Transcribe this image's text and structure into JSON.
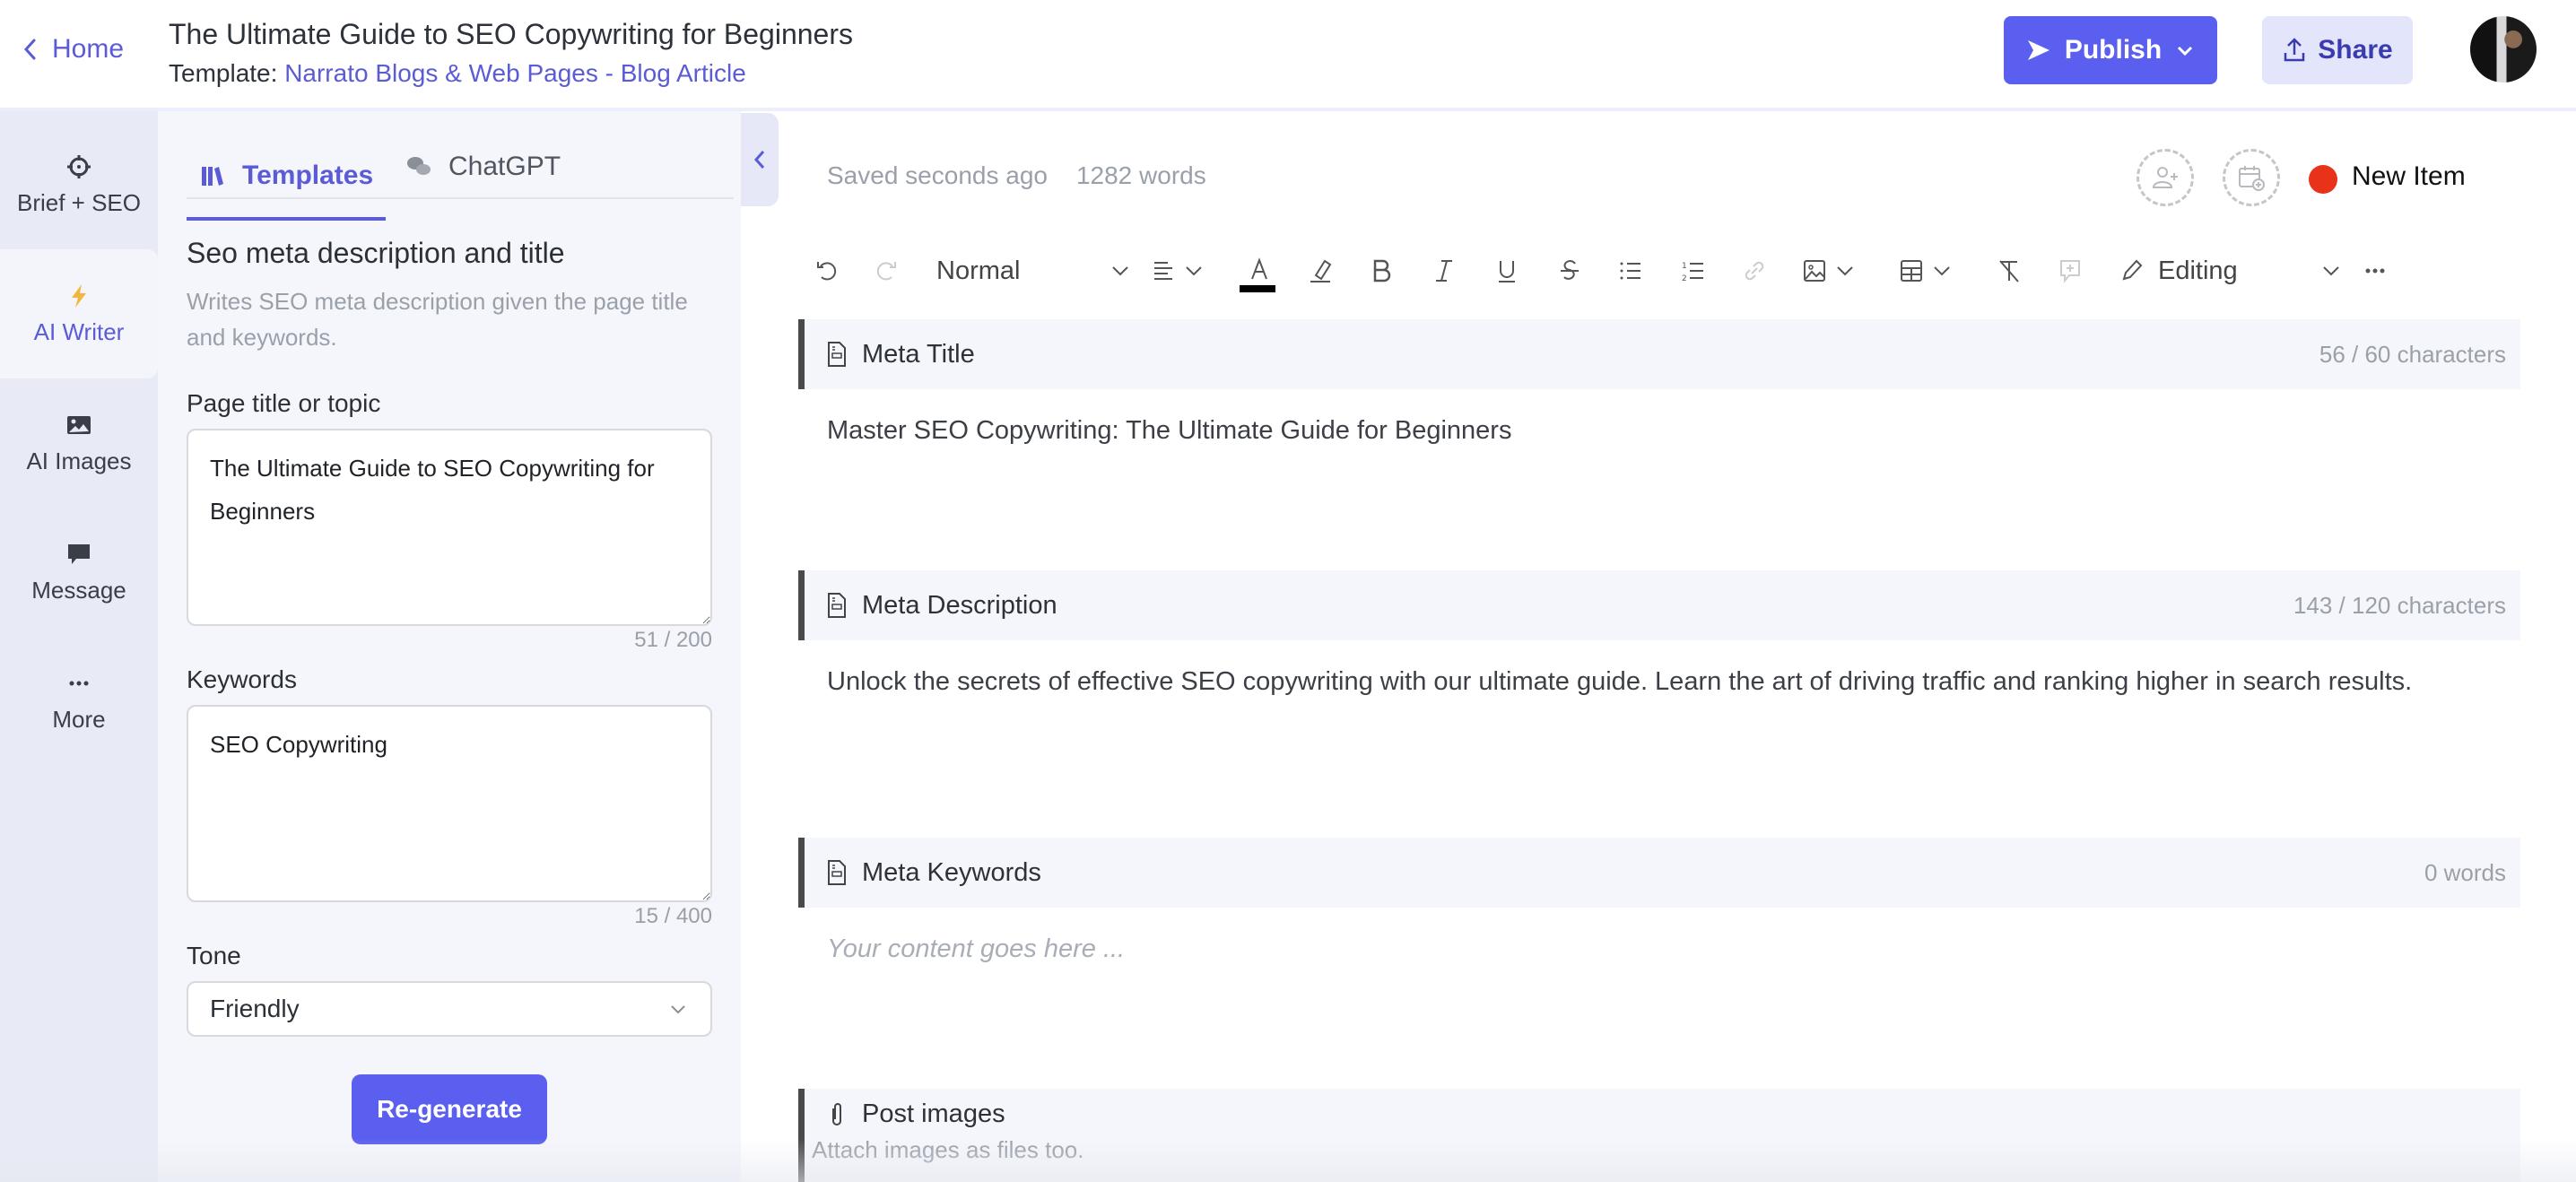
{
  "header": {
    "home_label": "Home",
    "doc_title": "The Ultimate Guide to SEO Copywriting for Beginners",
    "template_prefix": "Template:",
    "template_name": "Narrato Blogs & Web Pages - Blog Article",
    "publish_label": "Publish",
    "share_label": "Share"
  },
  "leftnav": {
    "items": [
      {
        "label": "Brief + SEO",
        "icon": "crosshair-icon"
      },
      {
        "label": "AI Writer",
        "icon": "lightning-icon",
        "active": true
      },
      {
        "label": "AI Images",
        "icon": "image-icon"
      },
      {
        "label": "Message",
        "icon": "chat-icon"
      },
      {
        "label": "More",
        "icon": "more-dots-icon"
      }
    ]
  },
  "template_panel": {
    "tabs": [
      {
        "label": "Templates",
        "icon": "books-icon",
        "active": true
      },
      {
        "label": "ChatGPT",
        "icon": "chat-bubbles-icon"
      }
    ],
    "title": "Seo meta description and title",
    "description": "Writes SEO meta description given the page title and keywords.",
    "fields": {
      "page_title": {
        "label": "Page title or topic",
        "value": "The Ultimate Guide to SEO Copywriting for Beginners",
        "counter": "51 / 200"
      },
      "keywords": {
        "label": "Keywords",
        "value": "SEO Copywriting",
        "counter": "15 / 400"
      },
      "tone": {
        "label": "Tone",
        "value": "Friendly"
      }
    },
    "regenerate_label": "Re-generate"
  },
  "editor": {
    "saved_status": "Saved seconds ago",
    "word_count": "1282 words",
    "item_status": {
      "label": "New Item",
      "color": "#e8331a"
    },
    "toolbar": {
      "paragraph_style": "Normal",
      "mode": "Editing",
      "font_color": "#000000"
    },
    "sections": [
      {
        "title": "Meta Title",
        "icon": "document-icon",
        "count": "56 / 60 characters",
        "content": "Master SEO Copywriting: The Ultimate Guide for Beginners"
      },
      {
        "title": "Meta Description",
        "icon": "document-icon",
        "count": "143 / 120 characters",
        "content": "Unlock the secrets of effective SEO copywriting with our ultimate guide. Learn the art of driving traffic and ranking higher in search results."
      },
      {
        "title": "Meta Keywords",
        "icon": "document-icon",
        "count": "0 words",
        "placeholder": "Your content goes here ..."
      },
      {
        "title": "Post images",
        "icon": "paperclip-icon",
        "hint": "Attach images as files too."
      }
    ]
  },
  "colors": {
    "accent": "#5b5fef",
    "accent_text": "#5b5bd6",
    "nav_bg": "#e8ebf5",
    "panel_bg": "#f5f6fc"
  }
}
